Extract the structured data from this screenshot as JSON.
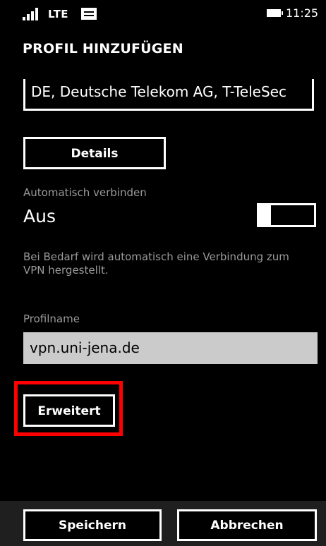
{
  "status_bar": {
    "network_type": "LTE",
    "time": "11:25",
    "icons": [
      "signal-icon",
      "message-icon",
      "battery-icon"
    ]
  },
  "page": {
    "title": "PROFIL HINZUFÜGEN"
  },
  "certificate": {
    "value": "DE, Deutsche Telekom AG, T-TeleSec"
  },
  "buttons": {
    "details": "Details",
    "advanced": "Erweitert",
    "save": "Speichern",
    "cancel": "Abbrechen"
  },
  "auto_connect": {
    "label": "Automatisch verbinden",
    "value": "Aus",
    "enabled": false,
    "description": "Bei Bedarf wird automatisch eine Verbindung zum VPN hergestellt."
  },
  "profile_name": {
    "label": "Profilname",
    "value": "vpn.uni-jena.de"
  },
  "colors": {
    "highlight": "#ff0000",
    "input_background": "#cbcbcb",
    "muted_text": "#9a9a9a"
  }
}
